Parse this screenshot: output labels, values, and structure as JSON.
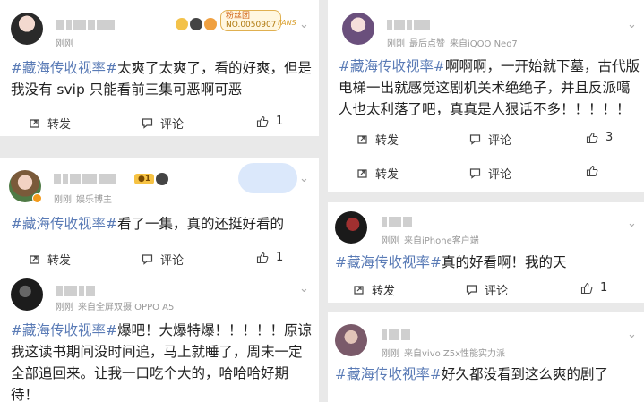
{
  "tag_text": "#藏海传收视率#",
  "action_labels": {
    "repost": "转发",
    "comment": "评论"
  },
  "posts": [
    {
      "meta_time": "刚刚",
      "text": "太爽了太爽了，看的好爽，但是我没有 svip 只能看前三集可恶啊可恶",
      "fans_badge_label": "粉丝团",
      "fans_badge_number": "NO.0050907",
      "fans_badge_suffix": "FANS",
      "like_count": "1"
    },
    {
      "meta_time": "刚刚",
      "meta_extra": "娱乐博主",
      "level": "1",
      "text": "看了一集，真的还挺好看的",
      "like_count": "1"
    },
    {
      "meta_time": "刚刚",
      "meta_source": "来自全屏双摄 OPPO A5",
      "text": "爆吧！大爆特爆！！！！！原谅我这读书期间没时间追，马上就睡了，周末一定全部追回来。让我一口吃个大的，哈哈哈好期待！"
    },
    {
      "meta_time": "刚刚",
      "meta_extra": "最后点赞",
      "meta_source": "来自iQOO Neo7",
      "text": "啊啊啊，一开始就下墓，古代版电梯一出就感觉这剧机关术绝绝子，并且反派噶人也太利落了吧，真真是人狠话不多！！！！！",
      "like_count": "3"
    },
    {
      "meta_time": "刚刚",
      "meta_source": "来自iPhone客户端",
      "text": "真的好看啊！我的天",
      "like_count": "1"
    },
    {
      "meta_time": "刚刚",
      "meta_source": "来自vivo Z5x性能实力派",
      "text": "好久都没看到这么爽的剧了"
    }
  ]
}
